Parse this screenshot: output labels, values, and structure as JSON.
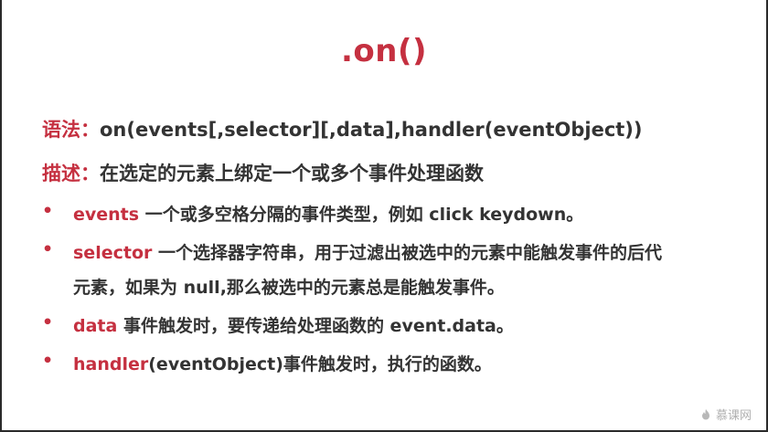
{
  "slide": {
    "title": ".on()",
    "syntax_label": "语法：",
    "syntax_text": "on(events[,selector][,data],handler(eventObject))",
    "desc_label": "描述：",
    "desc_text": "在选定的元素上绑定一个或多个事件处理函数",
    "bullets": [
      {
        "key": "events",
        "text": " 一个或多空格分隔的事件类型，例如 click keydown。"
      },
      {
        "key": "selector",
        "text": " 一个选择器字符串，用于过滤出被选中的元素中能触发事件的后代",
        "cont": "元素，如果为 null,那么被选中的元素总是能触发事件。"
      },
      {
        "key": "data",
        "text": " 事件触发时，要传递给处理函数的 event.data。"
      },
      {
        "key": "handler",
        "text": "(eventObject)事件触发时，执行的函数。"
      }
    ],
    "bullet_glyph": "•"
  },
  "watermark": {
    "text": "慕课网",
    "icon": "flame-icon"
  },
  "colors": {
    "accent": "#c53040",
    "body_text": "#333333",
    "watermark": "#b0b0b0"
  }
}
